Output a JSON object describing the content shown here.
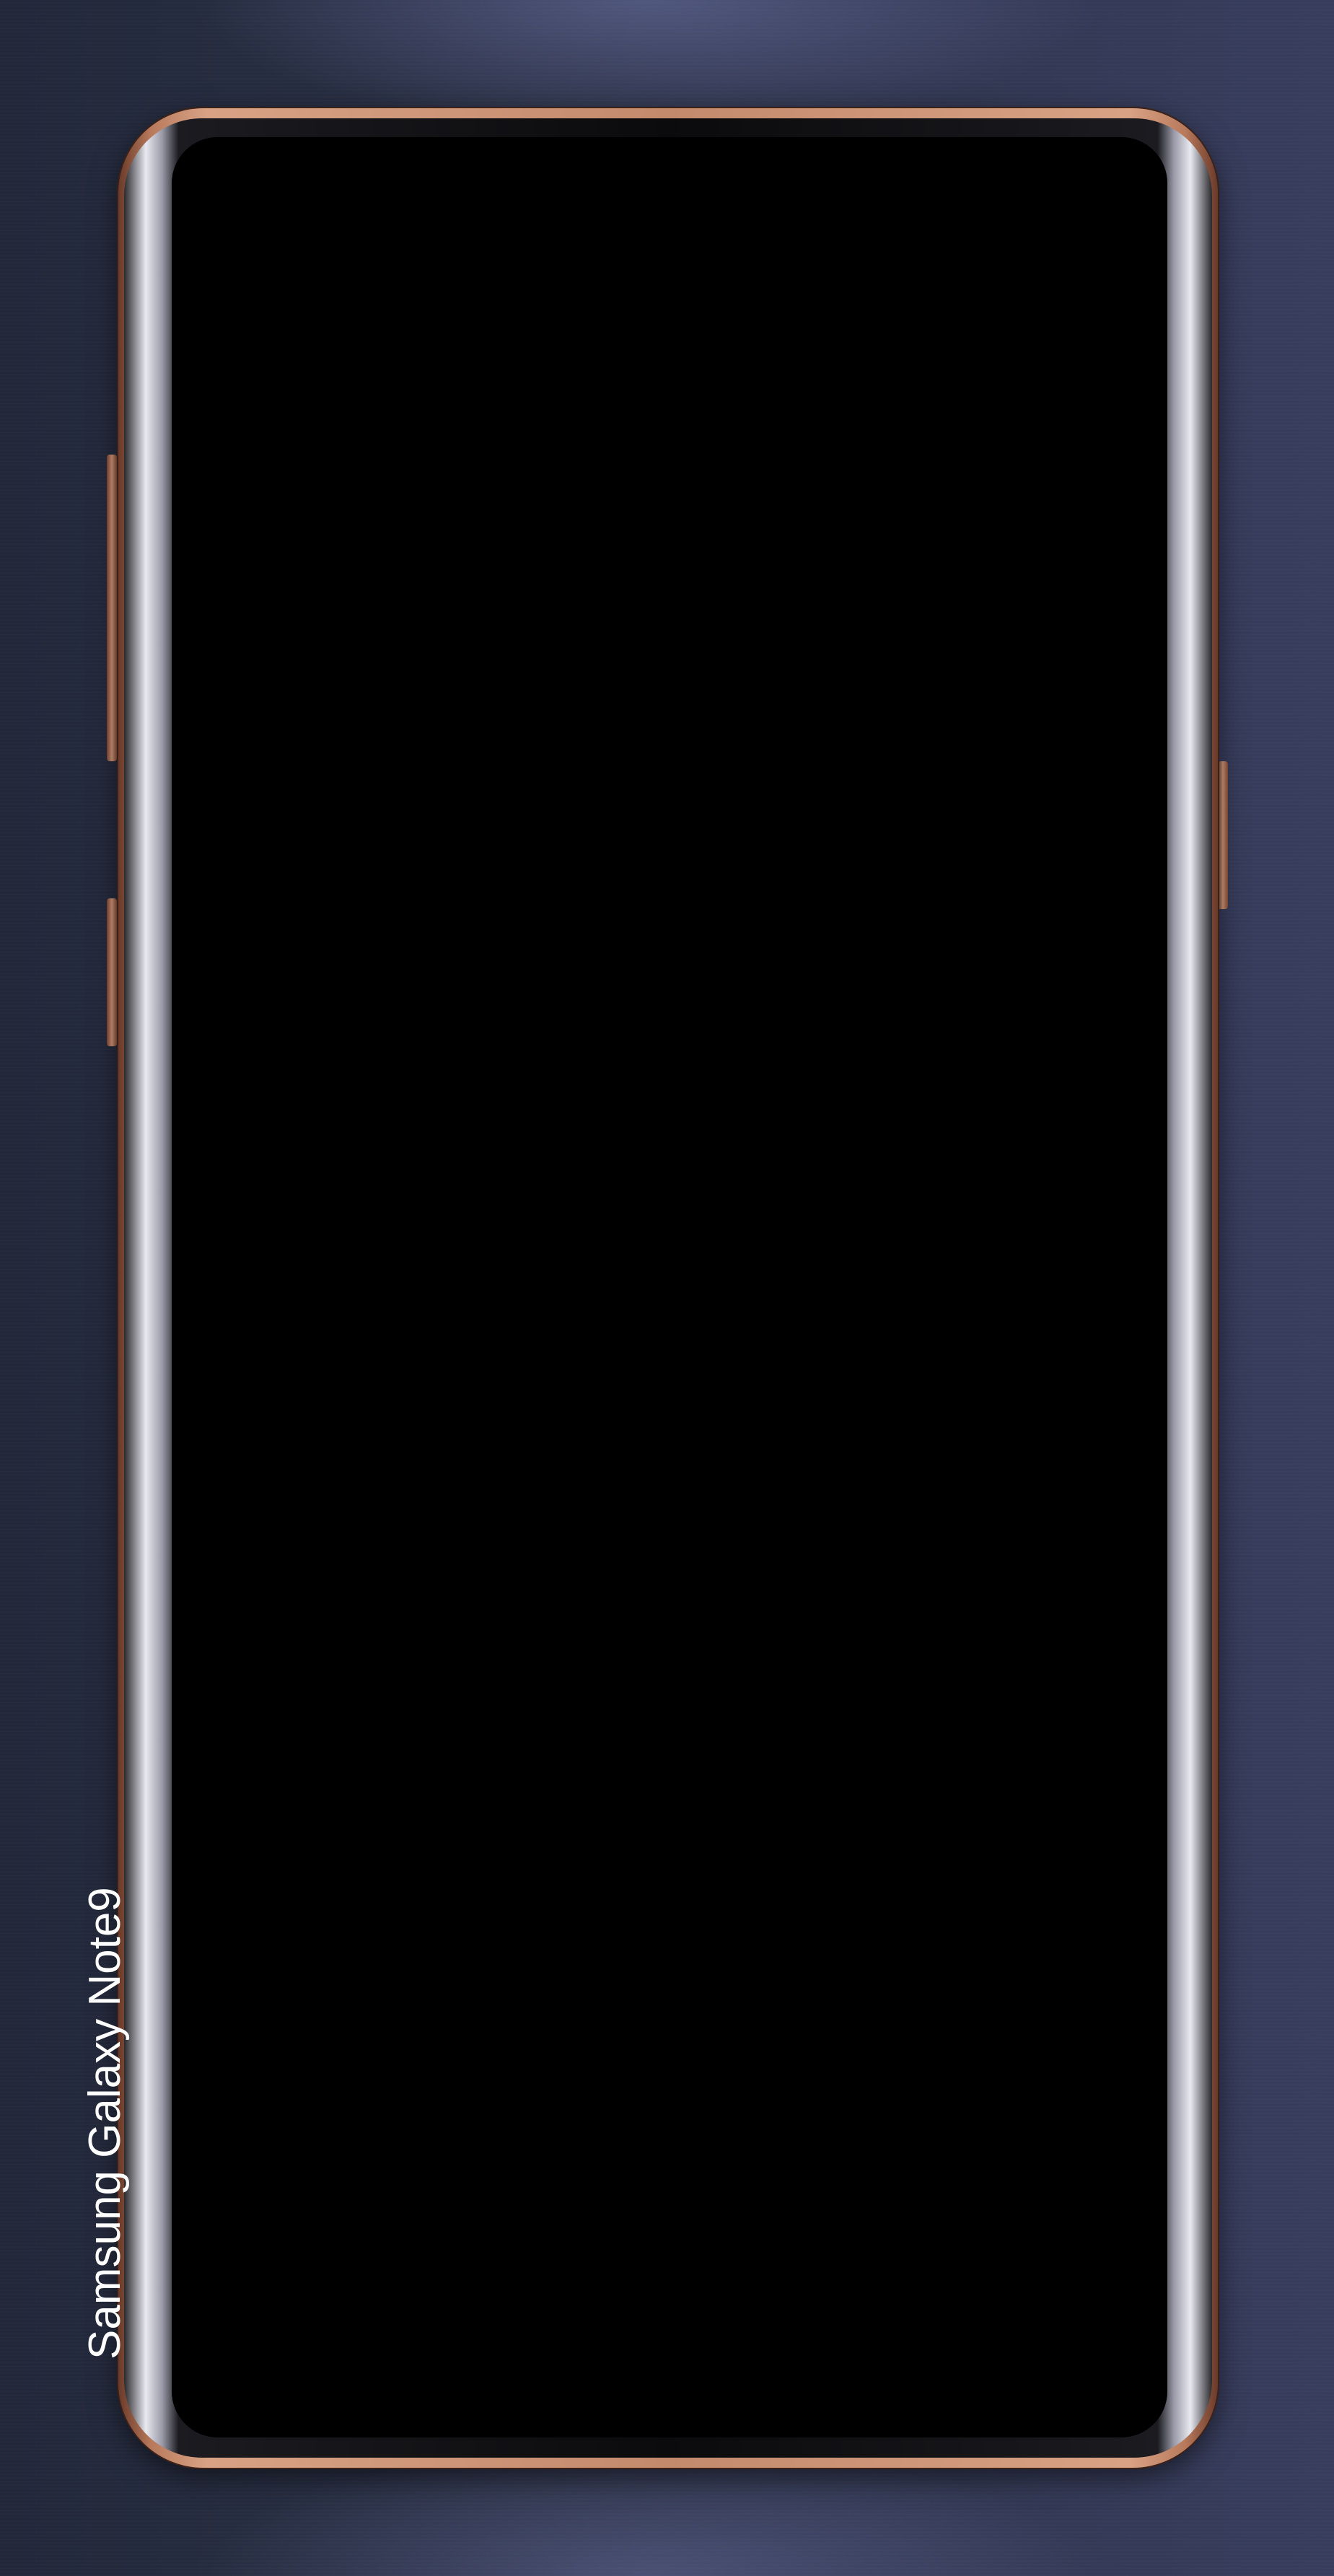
{
  "brand": {
    "label": "Samsung Galaxy Note9",
    "color": "#ffffff"
  },
  "device": {
    "frame_color": "#c48a6c",
    "screen_color": "#000000",
    "background_color": "#2c3247",
    "sensor_icons": [
      "iris-led-icon",
      "iris-camera-icon",
      "proximity-sensor-icon",
      "light-sensor-icon",
      "earpiece-icon",
      "front-camera-icon",
      "status-led-icon"
    ]
  }
}
